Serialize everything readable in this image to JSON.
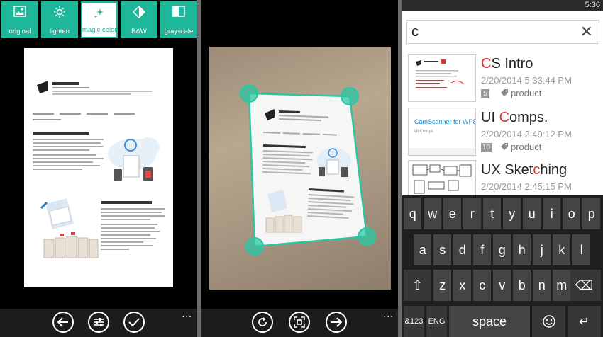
{
  "panel1": {
    "filters": [
      {
        "label": "original",
        "icon": "image-icon"
      },
      {
        "label": "lighten",
        "icon": "sun-icon"
      },
      {
        "label": "magic color",
        "icon": "sparkle-icon",
        "active": true
      },
      {
        "label": "B&W",
        "icon": "contrast-icon"
      },
      {
        "label": "grayscale",
        "icon": "grayscale-icon"
      }
    ],
    "more": "..."
  },
  "panel2": {
    "more": "..."
  },
  "panel3": {
    "time": "5:36",
    "search_value": "c",
    "clear_icon": "✕",
    "results": [
      {
        "title_hl": "C",
        "title_rest": "S Intro",
        "date": "2/20/2014 5:33:44 PM",
        "count": "5",
        "tag": "product"
      },
      {
        "title_pre": "UI ",
        "title_hl": "C",
        "title_rest": "omps.",
        "date": "2/20/2014 2:49:12 PM",
        "count": "10",
        "tag": "product"
      },
      {
        "title_pre": "UX Sket",
        "title_hl": "c",
        "title_rest": "hing",
        "date": "2/20/2014 2:45:15 PM",
        "count": "",
        "tag": ""
      }
    ],
    "keyboard": {
      "row1": [
        "q",
        "w",
        "e",
        "r",
        "t",
        "y",
        "u",
        "i",
        "o",
        "p"
      ],
      "row2": [
        "a",
        "s",
        "d",
        "f",
        "g",
        "h",
        "j",
        "k",
        "l"
      ],
      "row3": [
        "z",
        "x",
        "c",
        "v",
        "b",
        "n",
        "m"
      ],
      "shift": "⇧",
      "backspace": "⌫",
      "symbols": "&123",
      "lang": "ENG",
      "space": "space",
      "enter": "↵"
    }
  },
  "colors": {
    "accent": "#1fb79a",
    "highlight": "#e23232"
  }
}
